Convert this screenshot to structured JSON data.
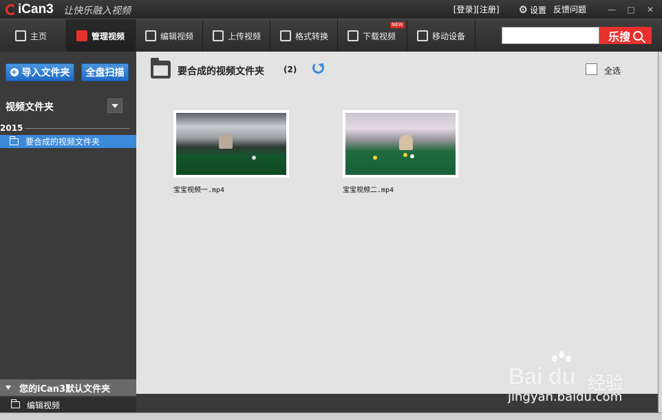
{
  "titlebar": {
    "app_name": "iCan3",
    "slogan": "让快乐融入视频",
    "login": "[登录]",
    "register": "[注册]",
    "settings": "设置",
    "feedback": "反馈问题",
    "minimize": "—",
    "maximize": "□",
    "close": "✕"
  },
  "nav": {
    "items": [
      {
        "label": "主页",
        "icon": "home-icon"
      },
      {
        "label": "管理视频",
        "icon": "manage-video-icon",
        "active": true
      },
      {
        "label": "编辑视频",
        "icon": "edit-video-icon"
      },
      {
        "label": "上传视频",
        "icon": "upload-icon"
      },
      {
        "label": "格式转换",
        "icon": "convert-icon"
      },
      {
        "label": "下载视频",
        "icon": "download-icon",
        "badge": "NEW"
      },
      {
        "label": "移动设备",
        "icon": "mobile-device-icon"
      }
    ],
    "search_placeholder": "",
    "search_button": "乐搜"
  },
  "sidebar": {
    "import_button": "导入文件夹",
    "scan_button": "全盘扫描",
    "section_title": "视频文件夹",
    "year": "2015",
    "folders": [
      {
        "label": "要合成的视频文件夹",
        "selected": true
      }
    ],
    "default_folder_label": "您的iCan3默认文件夹",
    "default_subfolder": "编辑视频"
  },
  "main": {
    "folder_title": "要合成的视频文件夹",
    "count": "(2)",
    "select_all": "全选",
    "videos": [
      {
        "name": "宝宝视频一.mp4"
      },
      {
        "name": "宝宝视频二.mp4"
      }
    ]
  },
  "watermark": {
    "brand": "Bai du",
    "brand_cn": "经验",
    "url": "jingyan.baidu.com"
  },
  "colors": {
    "accent_blue": "#3b8ad9",
    "brand_red": "#e8302c",
    "sidebar_bg": "#3b3b3b",
    "main_bg": "#e3e3e3"
  }
}
